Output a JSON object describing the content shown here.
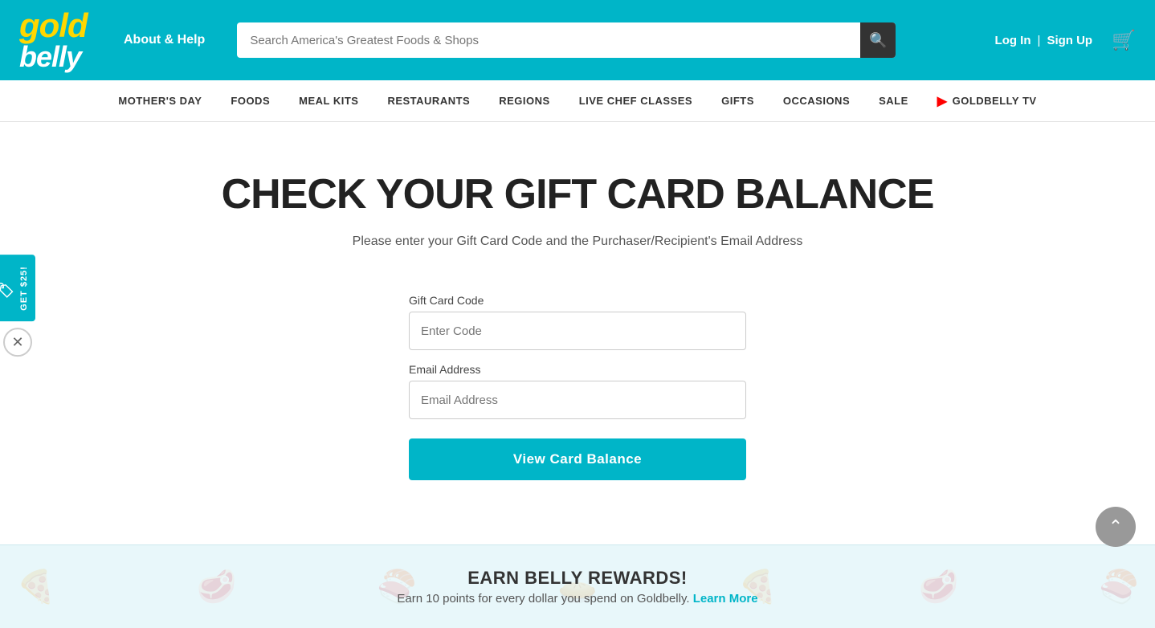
{
  "header": {
    "logo_line1": "GOLD",
    "logo_line2": "BeLLY",
    "about_help": "About & Help",
    "search_placeholder": "Search America's Greatest Foods & Shops",
    "login_label": "Log In",
    "divider": "|",
    "signup_label": "Sign Up"
  },
  "nav": {
    "items": [
      {
        "label": "MOTHER'S DAY"
      },
      {
        "label": "FOODS"
      },
      {
        "label": "MEAL KITS"
      },
      {
        "label": "RESTAURANTS"
      },
      {
        "label": "REGIONS"
      },
      {
        "label": "LIVE CHEF CLASSES"
      },
      {
        "label": "GIFTS"
      },
      {
        "label": "OCCASIONS"
      },
      {
        "label": "SALE"
      },
      {
        "label": "GOLDBELLY TV",
        "has_youtube": true
      }
    ]
  },
  "main": {
    "title": "CHECK YOUR GIFT CARD BALANCE",
    "subtitle": "Please enter your Gift Card Code and the Purchaser/Recipient's Email Address",
    "gift_card_label": "Gift Card Code",
    "gift_card_placeholder": "Enter Code",
    "email_label": "Email Address",
    "email_placeholder": "Email Address",
    "submit_label": "View Card Balance"
  },
  "side_promo": {
    "text": "GET $25!"
  },
  "footer": {
    "rewards_title": "EARN BELLY REWARDS!",
    "rewards_subtitle": "Earn 10 points for every dollar you spend on Goldbelly.",
    "rewards_link": "Learn More"
  }
}
